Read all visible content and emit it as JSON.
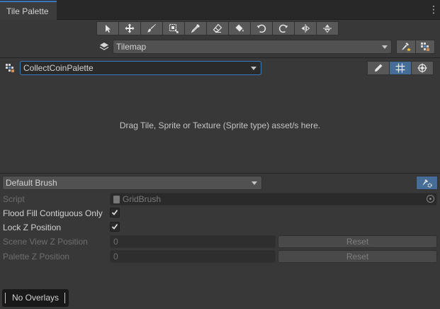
{
  "window": {
    "tab_label": "Tile Palette",
    "menu_icon": "kebab-menu-icon"
  },
  "toolbar": {
    "tools": [
      {
        "name": "select-tool",
        "icon": "arrow-icon"
      },
      {
        "name": "move-tool",
        "icon": "move-icon"
      },
      {
        "name": "paint-tool",
        "icon": "brush-icon"
      },
      {
        "name": "box-fill-tool",
        "icon": "box-fill-icon"
      },
      {
        "name": "picker-tool",
        "icon": "eyedropper-icon"
      },
      {
        "name": "erase-tool",
        "icon": "eraser-icon"
      },
      {
        "name": "fill-tool",
        "icon": "bucket-icon"
      },
      {
        "name": "rotate-ccw-tool",
        "icon": "rotate-ccw-icon"
      },
      {
        "name": "rotate-cw-tool",
        "icon": "rotate-cw-icon"
      },
      {
        "name": "flip-x-tool",
        "icon": "flip-x-icon"
      },
      {
        "name": "flip-y-tool",
        "icon": "flip-y-icon"
      }
    ]
  },
  "target": {
    "tilemap_value": "Tilemap"
  },
  "palette": {
    "selected": "CollectCoinPalette"
  },
  "drop_area": {
    "message": "Drag Tile, Sprite or Texture (Sprite type) asset/s here."
  },
  "brush": {
    "selected": "Default Brush",
    "script_label": "Script",
    "script_value": "GridBrush",
    "flood_fill_label": "Flood Fill Contiguous Only",
    "lock_z_label": "Lock Z Position",
    "scene_z_label": "Scene View Z Position",
    "scene_z_value": "0",
    "palette_z_label": "Palette Z Position",
    "palette_z_value": "0",
    "reset_label": "Reset"
  },
  "overlays": {
    "label": "No Overlays"
  },
  "colors": {
    "accent": "#3a79bb",
    "active_button": "#466d97",
    "background": "#383838"
  }
}
